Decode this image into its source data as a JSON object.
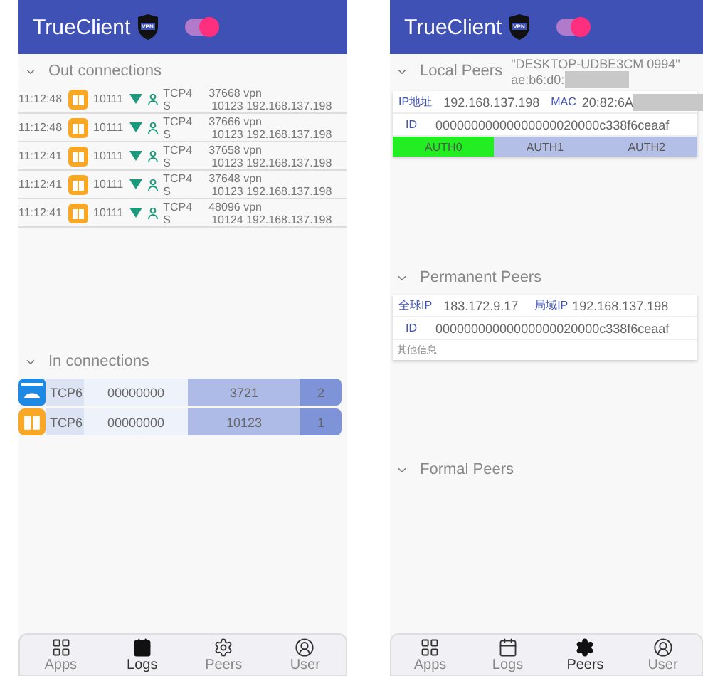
{
  "screens": [
    {
      "app_title": "TrueClient",
      "vpn_badge": "VPN",
      "vpn_on": true,
      "sections": [
        {
          "kind": "logs",
          "title": "Out connections",
          "expanded": true,
          "rows": [
            {
              "time": "11:12:48",
              "uid": "10111",
              "proto": "TCP4",
              "state": "S",
              "port": "37668 vpn",
              "remote": "10123 192.168.137.198"
            },
            {
              "time": "11:12:48",
              "uid": "10111",
              "proto": "TCP4",
              "state": "S",
              "port": "37666 vpn",
              "remote": "10123 192.168.137.198"
            },
            {
              "time": "11:12:41",
              "uid": "10111",
              "proto": "TCP4",
              "state": "S",
              "port": "37658 vpn",
              "remote": "10123 192.168.137.198"
            },
            {
              "time": "11:12:41",
              "uid": "10111",
              "proto": "TCP4",
              "state": "S",
              "port": "37648 vpn",
              "remote": "10123 192.168.137.198"
            },
            {
              "time": "11:12:41",
              "uid": "10111",
              "proto": "TCP4",
              "state": "S",
              "port": "48096 vpn",
              "remote": "10124 192.168.137.198"
            }
          ]
        },
        {
          "kind": "inbound",
          "title": "In connections",
          "expanded": true,
          "rows": [
            {
              "kind": "cloud",
              "proto": "TCP6",
              "address": "00000000",
              "port": "3721",
              "count": "2"
            },
            {
              "kind": "book",
              "proto": "TCP6",
              "address": "00000000",
              "port": "10123",
              "count": "1"
            }
          ]
        }
      ],
      "nav": [
        {
          "label": "Apps",
          "selected": false
        },
        {
          "label": "Logs",
          "selected": true
        },
        {
          "label": "Peers",
          "selected": false
        },
        {
          "label": "User",
          "selected": false
        }
      ]
    },
    {
      "app_title": "TrueClient",
      "vpn_badge": "VPN",
      "vpn_on": true,
      "sections": [
        {
          "kind": "local",
          "title": "Local Peers",
          "expanded": true,
          "host": "\"DESKTOP-UDBE3CM 0994\"",
          "host_mac": "ae:b6:d0:",
          "card": {
            "ip_label": "IP地址",
            "ip": "192.168.137.198",
            "mac_label": "MAC",
            "mac": "20:82:6A",
            "id_label": "ID",
            "id": "00000000000000000020000c338f6ceaaf",
            "auth": [
              {
                "label": "AUTH0",
                "selected": true
              },
              {
                "label": "AUTH1",
                "selected": false
              },
              {
                "label": "AUTH2",
                "selected": false
              }
            ]
          }
        },
        {
          "kind": "permanent",
          "title": "Permanent Peers",
          "expanded": true,
          "card": {
            "global_label": "全球IP",
            "global_ip": "183.172.9.17",
            "lan_label": "局域IP",
            "lan_ip": "192.168.137.198",
            "id_label": "ID",
            "id": "00000000000000000020000c338f6ceaaf",
            "other": "其他信息"
          }
        },
        {
          "kind": "formal",
          "title": "Formal Peers",
          "expanded": true
        }
      ],
      "nav": [
        {
          "label": "Apps",
          "selected": false
        },
        {
          "label": "Logs",
          "selected": false
        },
        {
          "label": "Peers",
          "selected": true
        },
        {
          "label": "User",
          "selected": false
        }
      ]
    }
  ]
}
